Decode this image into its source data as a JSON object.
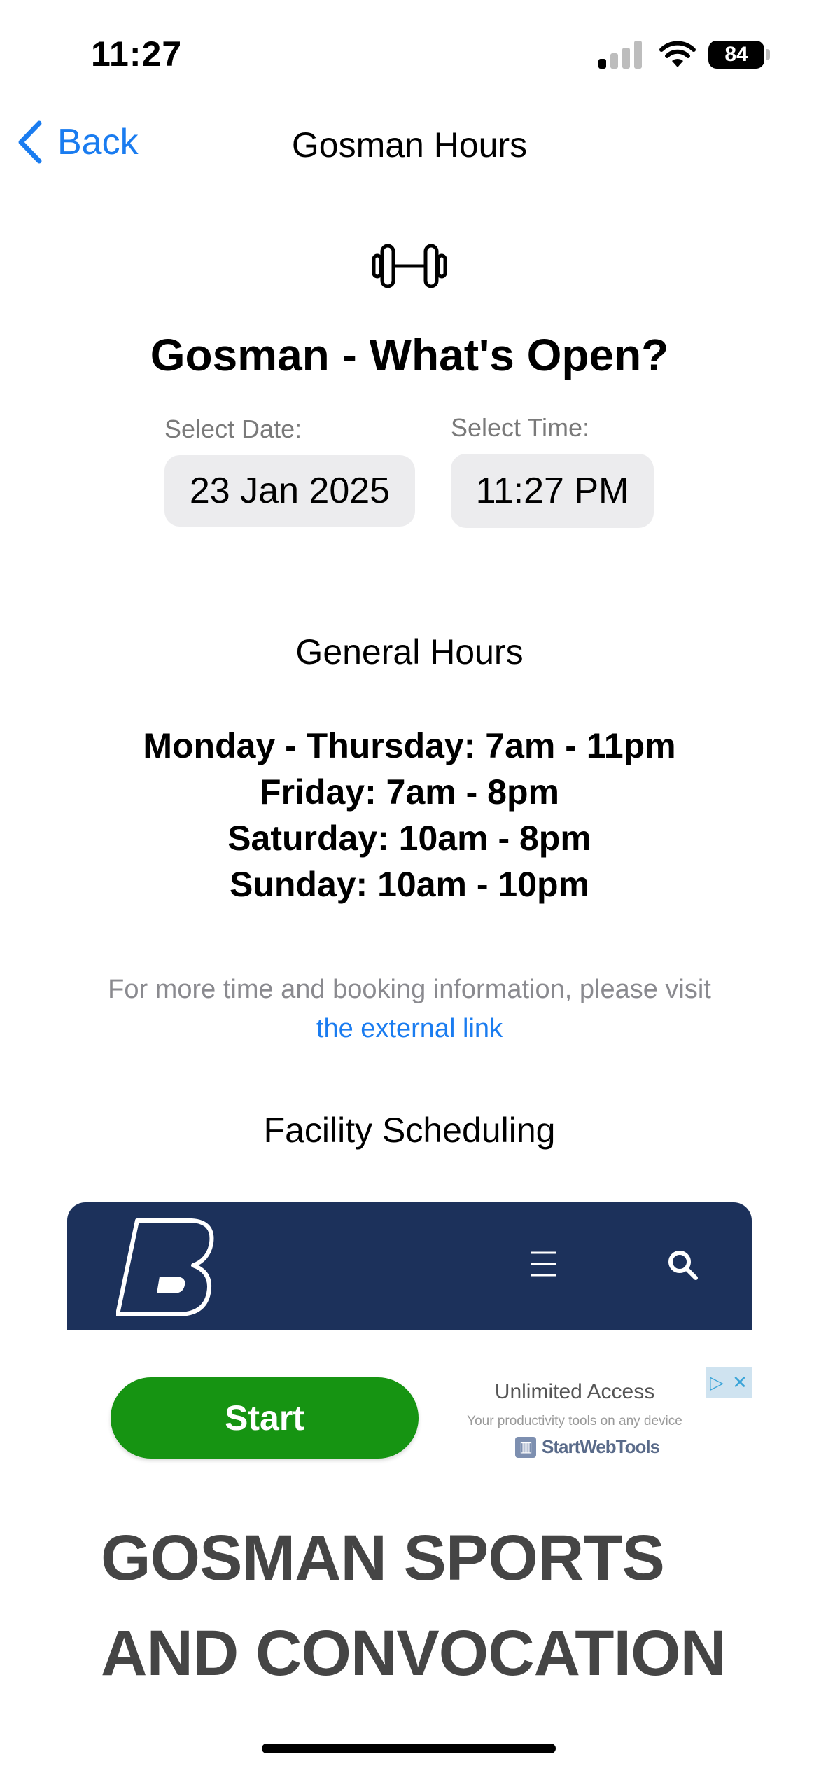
{
  "status_bar": {
    "time": "11:27",
    "battery": "84"
  },
  "nav": {
    "back_label": "Back",
    "title": "Gosman Hours"
  },
  "main": {
    "icon": "dumbbell-icon",
    "headline": "Gosman - What's Open?",
    "date_picker": {
      "label": "Select Date:",
      "value": "23 Jan 2025"
    },
    "time_picker": {
      "label": "Select Time:",
      "value": "11:27 PM"
    },
    "general_hours_title": "General Hours",
    "hours": [
      "Monday - Thursday: 7am - 11pm",
      "Friday: 7am - 8pm",
      "Saturday: 10am - 8pm",
      "Sunday: 10am - 10pm"
    ],
    "info_text": "For more time and booking information, please visit",
    "info_link": "the external link",
    "facility_title": "Facility Scheduling"
  },
  "webview": {
    "header_color": "#1c315b",
    "ad": {
      "button_label": "Start",
      "title": "Unlimited Access",
      "subtitle": "Your productivity tools on any device",
      "brand": "StartWebTools"
    },
    "heading": "GOSMAN SPORTS AND CONVOCATION"
  },
  "colors": {
    "accent": "#1a7cf0",
    "ad_green": "#169412",
    "picker_bg": "#ececee"
  }
}
